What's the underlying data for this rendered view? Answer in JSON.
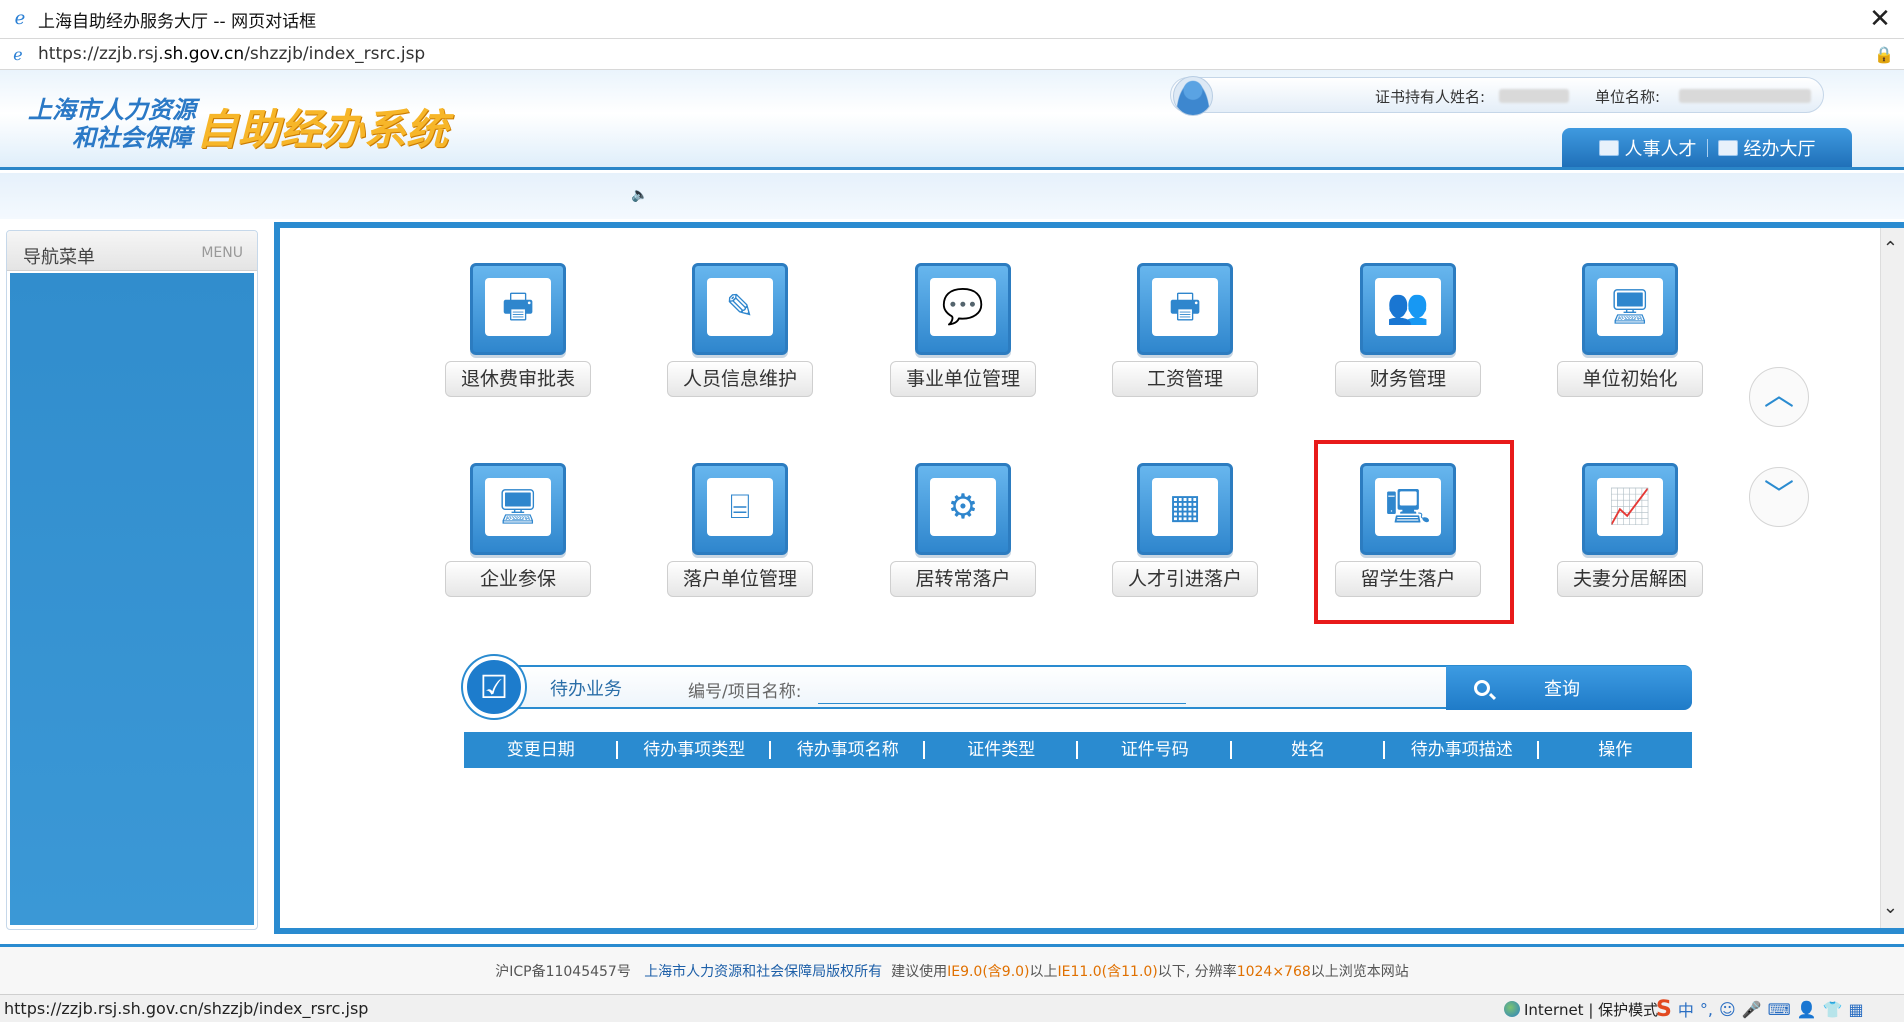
{
  "window": {
    "title": "上海自助经办服务大厅 -- 网页对话框",
    "close_glyph": "✕"
  },
  "address": {
    "scheme": "https://",
    "host_prefix": "zzjb.rsj.",
    "host_main": "sh.gov.cn",
    "path": "/shzzjb/index_rsrc.jsp"
  },
  "header": {
    "logo_line1": "上海市人力资源",
    "logo_line2": "和社会保障",
    "logo_main": "自助经办系统",
    "holder_label": "证书持有人姓名:",
    "unit_label": "单位名称:",
    "tabs": [
      {
        "label": "人事人才"
      },
      {
        "label": "经办大厅"
      }
    ]
  },
  "sidebar": {
    "title": "导航菜单",
    "menu_tag": "MENU"
  },
  "tiles": [
    {
      "label": "退休费审批表",
      "icon": "printer-icon",
      "glyph": "🖶"
    },
    {
      "label": "人员信息维护",
      "icon": "document-edit-icon",
      "glyph": "✎"
    },
    {
      "label": "事业单位管理",
      "icon": "chat-bubble-icon",
      "glyph": "💬"
    },
    {
      "label": "工资管理",
      "icon": "printer-icon",
      "glyph": "🖶"
    },
    {
      "label": "财务管理",
      "icon": "presentation-icon",
      "glyph": "👥"
    },
    {
      "label": "单位初始化",
      "icon": "monitor-icon",
      "glyph": "🖥"
    },
    {
      "label": "企业参保",
      "icon": "monitor-icon",
      "glyph": "🖥"
    },
    {
      "label": "落户单位管理",
      "icon": "desk-icon",
      "glyph": "⌸"
    },
    {
      "label": "居转常落户",
      "icon": "settings-window-icon",
      "glyph": "⚙"
    },
    {
      "label": "人才引进落户",
      "icon": "calendar-icon",
      "glyph": "▦"
    },
    {
      "label": "留学生落户",
      "icon": "computer-tower-icon",
      "glyph": "🖳"
    },
    {
      "label": "夫妻分居解困",
      "icon": "chart-line-icon",
      "glyph": "📈"
    }
  ],
  "nav_arrows": {
    "up_glyph": "︿",
    "down_glyph": "﹀"
  },
  "todo": {
    "title": "待办业务",
    "search_label": "编号/项目名称:",
    "search_value": "",
    "search_button": "查询",
    "columns": [
      "变更日期",
      "待办事项类型",
      "待办事项名称",
      "证件类型",
      "证件号码",
      "姓名",
      "待办事项描述",
      "操作"
    ]
  },
  "footer": {
    "icp": "沪ICP备11045457号",
    "copyright": "上海市人力资源和社会保障局版权所有",
    "advice_1": "建议使用",
    "ie9": "IE9.0(含9.0)",
    "advice_2": "以上",
    "ie11": "IE11.0(含11.0)",
    "advice_3": "以下, 分辨率",
    "resolution": "1024×768",
    "advice_4": "以上浏览本网站"
  },
  "statusbar": {
    "url": "https://zzjb.rsj.sh.gov.cn/shzzjb/index_rsrc.jsp",
    "zone": "Internet | 保护模式",
    "ime": "中"
  },
  "colors": {
    "primary": "#2a8bd0",
    "highlight": "#e81a1a",
    "logo_orange": "#f7b629"
  }
}
